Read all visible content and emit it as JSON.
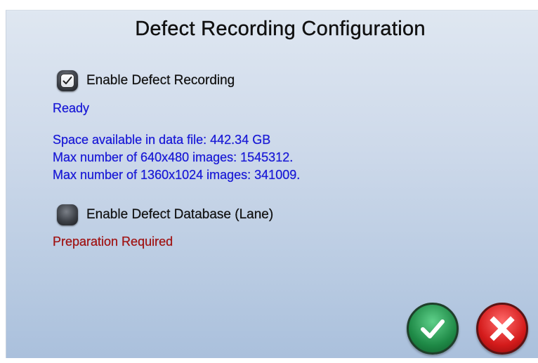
{
  "dialog": {
    "title": "Defect Recording Configuration"
  },
  "recording": {
    "checkbox_label": "Enable Defect Recording",
    "checked": true,
    "status": "Ready",
    "status_color": "#1a1ad6",
    "info": [
      "Space available in data file: 442.34 GB",
      "Max number of 640x480 images: 1545312.",
      "Max number of 1360x1024 images: 341009."
    ]
  },
  "database": {
    "checkbox_label": "Enable Defect Database (Lane)",
    "checked": false,
    "status": "Preparation Required",
    "status_color": "#a01414"
  },
  "buttons": {
    "ok_icon": "checkmark-icon",
    "cancel_icon": "x-icon",
    "ok_color": "#1f8a47",
    "cancel_color": "#d41b1b"
  }
}
